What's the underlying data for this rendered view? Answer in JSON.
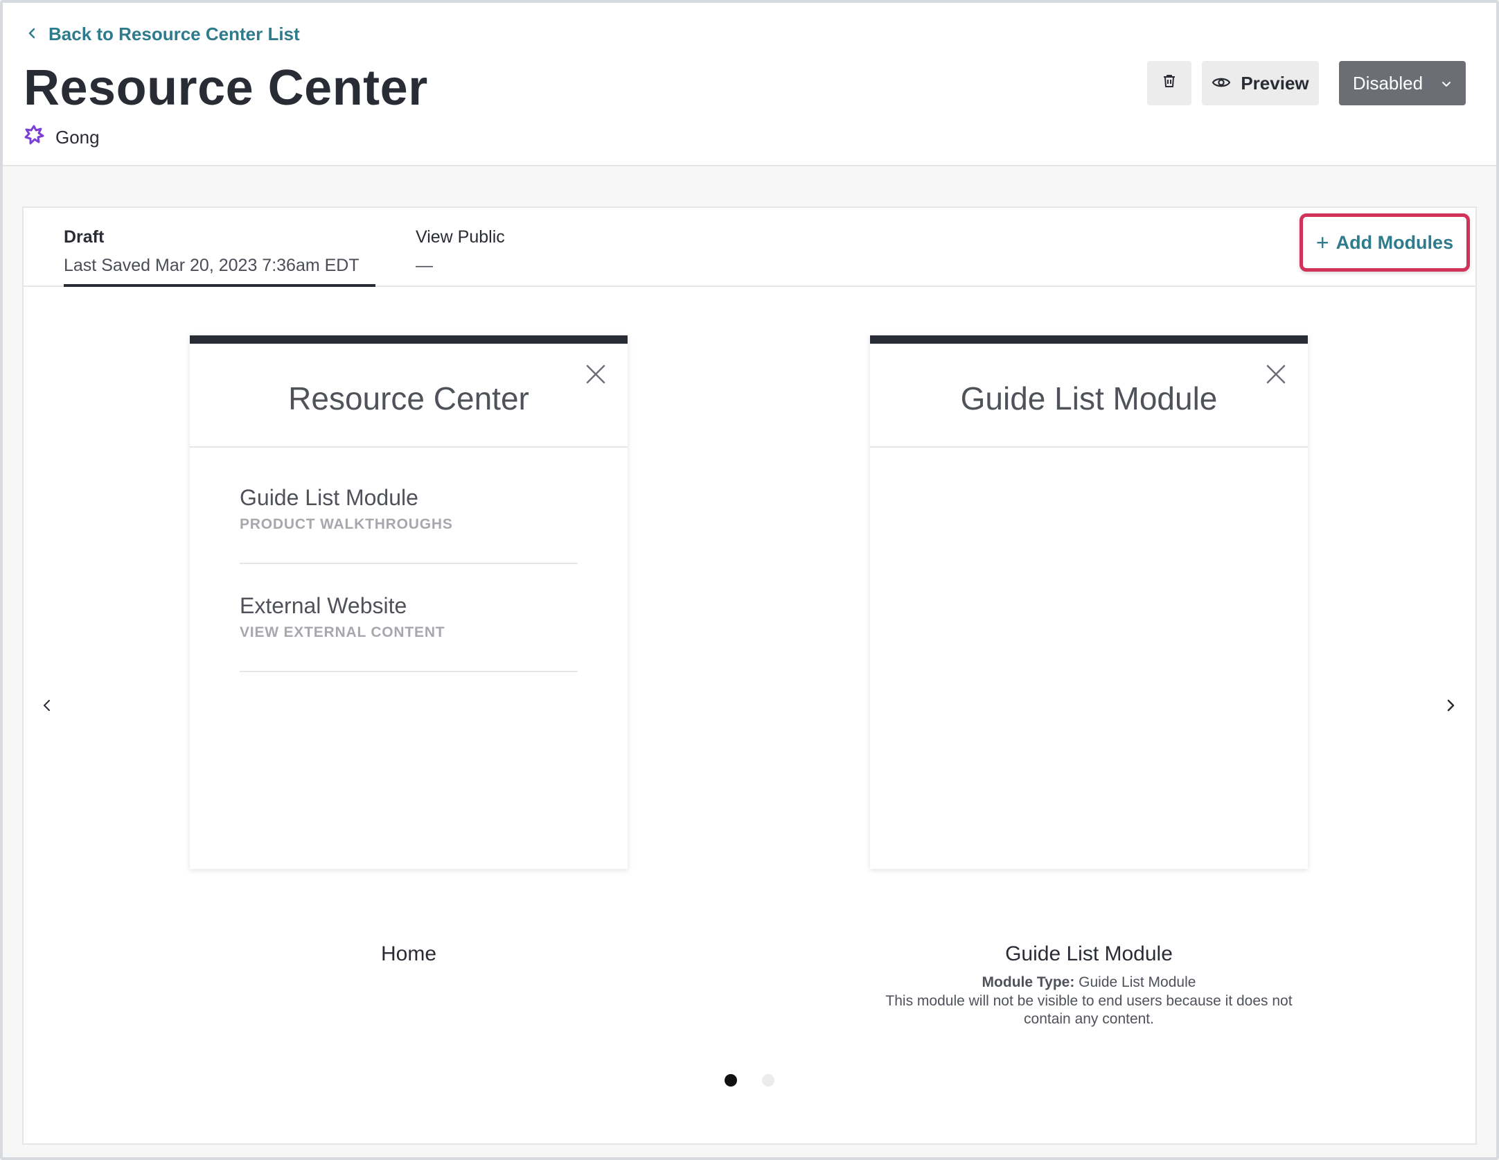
{
  "header": {
    "back_label": "Back to Resource Center List",
    "title": "Resource Center",
    "app_name": "Gong",
    "preview_label": "Preview",
    "status_label": "Disabled"
  },
  "tabs": {
    "draft": {
      "title": "Draft",
      "subtitle": "Last Saved Mar 20, 2023 7:36am EDT"
    },
    "public": {
      "title": "View Public",
      "subtitle": "—"
    }
  },
  "add_modules_label": "Add Modules",
  "add_modules_plus": "+",
  "panels": {
    "home": {
      "title": "Resource Center",
      "modules": [
        {
          "name": "Guide List Module",
          "subtitle": "PRODUCT WALKTHROUGHS"
        },
        {
          "name": "External Website",
          "subtitle": "VIEW EXTERNAL CONTENT"
        }
      ],
      "caption": "Home"
    },
    "guide": {
      "title": "Guide List Module",
      "caption": "Guide List Module",
      "type_label": "Module Type:",
      "type_value": "Guide List Module",
      "note": "This module will not be visible to end users because it does not contain any content."
    }
  },
  "pagination": {
    "current": 1,
    "total": 2
  },
  "colors": {
    "accent": "#2d7b8c",
    "highlight": "#d1325a",
    "status_bg": "#6b6e75",
    "dark_bar": "#2a2c35",
    "app_icon": "#7b3fd4"
  }
}
